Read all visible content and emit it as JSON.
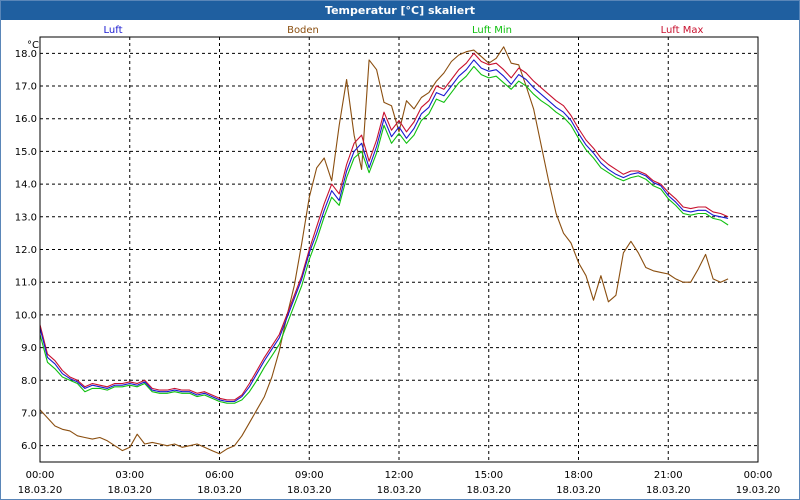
{
  "chart_data": {
    "type": "line",
    "title": "Temperatur [°C] skaliert",
    "ylabel": "°C",
    "xlabel": "",
    "ylim": [
      5.5,
      18.5
    ],
    "yticks": [
      "18.0",
      "17.0",
      "16.0",
      "15.0",
      "14.0",
      "13.0",
      "12.0",
      "11.0",
      "10.0",
      "9.0",
      "8.0",
      "7.0",
      "6.0"
    ],
    "ytick_values": [
      18,
      17,
      16,
      15,
      14,
      13,
      12,
      11,
      10,
      9,
      8,
      7,
      6
    ],
    "x_range_hours": [
      0,
      24
    ],
    "xticks": [
      {
        "time": "00:00",
        "date": "18.03.20"
      },
      {
        "time": "03:00",
        "date": "18.03.20"
      },
      {
        "time": "06:00",
        "date": "18.03.20"
      },
      {
        "time": "09:00",
        "date": "18.03.20"
      },
      {
        "time": "12:00",
        "date": "18.03.20"
      },
      {
        "time": "15:00",
        "date": "18.03.20"
      },
      {
        "time": "18:00",
        "date": "18.03.20"
      },
      {
        "time": "21:00",
        "date": "18.03.20"
      },
      {
        "time": "00:00",
        "date": "19.03.20"
      }
    ],
    "grid": true,
    "legend": "top",
    "x_hours": [
      0,
      0.25,
      0.5,
      0.75,
      1,
      1.25,
      1.5,
      1.75,
      2,
      2.25,
      2.5,
      2.75,
      3,
      3.25,
      3.5,
      3.75,
      4,
      4.25,
      4.5,
      4.75,
      5,
      5.25,
      5.5,
      5.75,
      6,
      6.25,
      6.5,
      6.75,
      7,
      7.25,
      7.5,
      7.75,
      8,
      8.25,
      8.5,
      8.75,
      9,
      9.25,
      9.5,
      9.75,
      10,
      10.25,
      10.5,
      10.75,
      11,
      11.25,
      11.5,
      11.75,
      12,
      12.25,
      12.5,
      12.75,
      13,
      13.25,
      13.5,
      13.75,
      14,
      14.25,
      14.5,
      14.75,
      15,
      15.25,
      15.5,
      15.75,
      16,
      16.25,
      16.5,
      16.75,
      17,
      17.25,
      17.5,
      17.75,
      18,
      18.25,
      18.5,
      18.75,
      19,
      19.25,
      19.5,
      19.75,
      20,
      20.25,
      20.5,
      20.75,
      21,
      21.25,
      21.5,
      21.75,
      22,
      22.25,
      22.5,
      22.75,
      23,
      23.25,
      23.5,
      23.75
    ],
    "series": [
      {
        "name": "Luft",
        "color": "#1a1ad0",
        "values": [
          9.6,
          8.7,
          8.5,
          8.2,
          8.05,
          7.95,
          7.75,
          7.85,
          7.8,
          7.75,
          7.85,
          7.85,
          7.9,
          7.85,
          7.95,
          7.7,
          7.65,
          7.65,
          7.7,
          7.65,
          7.65,
          7.55,
          7.6,
          7.5,
          7.4,
          7.35,
          7.35,
          7.5,
          7.8,
          8.2,
          8.6,
          8.95,
          9.3,
          9.9,
          10.5,
          11.1,
          11.9,
          12.5,
          13.2,
          13.8,
          13.5,
          14.4,
          15.0,
          15.25,
          14.5,
          15.15,
          16.0,
          15.45,
          15.75,
          15.4,
          15.7,
          16.15,
          16.35,
          16.8,
          16.7,
          17.0,
          17.3,
          17.5,
          17.8,
          17.55,
          17.45,
          17.5,
          17.3,
          17.05,
          17.35,
          17.2,
          16.95,
          16.75,
          16.55,
          16.35,
          16.2,
          15.95,
          15.55,
          15.2,
          14.95,
          14.65,
          14.45,
          14.3,
          14.2,
          14.3,
          14.35,
          14.25,
          14.05,
          13.95,
          13.65,
          13.45,
          13.2,
          13.15,
          13.2,
          13.2,
          13.05,
          13.0,
          12.95
        ]
      },
      {
        "name": "Boden",
        "color": "#8b4f10",
        "values": [
          7.1,
          6.85,
          6.6,
          6.5,
          6.45,
          6.3,
          6.25,
          6.2,
          6.25,
          6.15,
          6.0,
          5.85,
          5.95,
          6.35,
          6.05,
          6.1,
          6.05,
          6.0,
          6.05,
          5.95,
          6.0,
          6.05,
          5.95,
          5.85,
          5.75,
          5.9,
          6.0,
          6.3,
          6.7,
          7.1,
          7.5,
          8.1,
          8.9,
          9.95,
          10.9,
          12.2,
          13.6,
          14.5,
          14.8,
          14.1,
          15.8,
          17.2,
          15.5,
          14.45,
          17.8,
          17.5,
          16.5,
          16.4,
          15.6,
          16.55,
          16.3,
          16.65,
          16.8,
          17.15,
          17.4,
          17.75,
          17.95,
          18.05,
          18.1,
          17.9,
          17.7,
          17.85,
          18.2,
          17.7,
          17.65,
          17.0,
          16.3,
          15.2,
          14.1,
          13.1,
          12.5,
          12.2,
          11.6,
          11.2,
          10.45,
          11.2,
          10.4,
          10.6,
          11.9,
          12.25,
          11.9,
          11.45,
          11.35,
          11.3,
          11.25,
          11.1,
          11.0,
          11.0,
          11.4,
          11.85,
          11.1,
          11.0,
          11.1
        ]
      },
      {
        "name": "Luft Min",
        "color": "#10c010",
        "values": [
          9.4,
          8.55,
          8.35,
          8.1,
          8.0,
          7.9,
          7.65,
          7.75,
          7.75,
          7.7,
          7.8,
          7.8,
          7.85,
          7.8,
          7.9,
          7.65,
          7.6,
          7.6,
          7.65,
          7.6,
          7.6,
          7.5,
          7.55,
          7.45,
          7.35,
          7.3,
          7.3,
          7.4,
          7.65,
          8.0,
          8.4,
          8.75,
          9.1,
          9.7,
          10.3,
          10.9,
          11.7,
          12.3,
          13.0,
          13.6,
          13.35,
          14.2,
          14.8,
          15.0,
          14.35,
          14.95,
          15.8,
          15.25,
          15.55,
          15.25,
          15.5,
          15.95,
          16.15,
          16.6,
          16.5,
          16.8,
          17.1,
          17.3,
          17.6,
          17.35,
          17.25,
          17.3,
          17.1,
          16.9,
          17.15,
          17.0,
          16.75,
          16.55,
          16.4,
          16.2,
          16.05,
          15.8,
          15.4,
          15.05,
          14.8,
          14.5,
          14.35,
          14.2,
          14.1,
          14.2,
          14.25,
          14.15,
          13.95,
          13.85,
          13.55,
          13.35,
          13.1,
          13.05,
          13.1,
          13.1,
          12.95,
          12.9,
          12.75
        ]
      },
      {
        "name": "Luft Max",
        "color": "#c8102e",
        "values": [
          9.7,
          8.8,
          8.6,
          8.3,
          8.1,
          8.0,
          7.8,
          7.9,
          7.85,
          7.8,
          7.9,
          7.9,
          7.95,
          7.9,
          8.0,
          7.75,
          7.7,
          7.7,
          7.75,
          7.7,
          7.7,
          7.6,
          7.65,
          7.55,
          7.45,
          7.4,
          7.4,
          7.55,
          7.9,
          8.3,
          8.7,
          9.05,
          9.4,
          10.0,
          10.6,
          11.2,
          12.0,
          12.7,
          13.4,
          14.0,
          13.7,
          14.6,
          15.25,
          15.5,
          14.7,
          15.35,
          16.2,
          15.65,
          15.95,
          15.6,
          15.9,
          16.35,
          16.55,
          17.0,
          16.9,
          17.2,
          17.5,
          17.7,
          18.0,
          17.75,
          17.65,
          17.7,
          17.5,
          17.25,
          17.55,
          17.4,
          17.15,
          16.95,
          16.75,
          16.55,
          16.4,
          16.1,
          15.7,
          15.35,
          15.1,
          14.8,
          14.6,
          14.45,
          14.3,
          14.4,
          14.4,
          14.3,
          14.1,
          14.0,
          13.75,
          13.55,
          13.3,
          13.25,
          13.3,
          13.3,
          13.15,
          13.1,
          13.0
        ]
      }
    ]
  }
}
